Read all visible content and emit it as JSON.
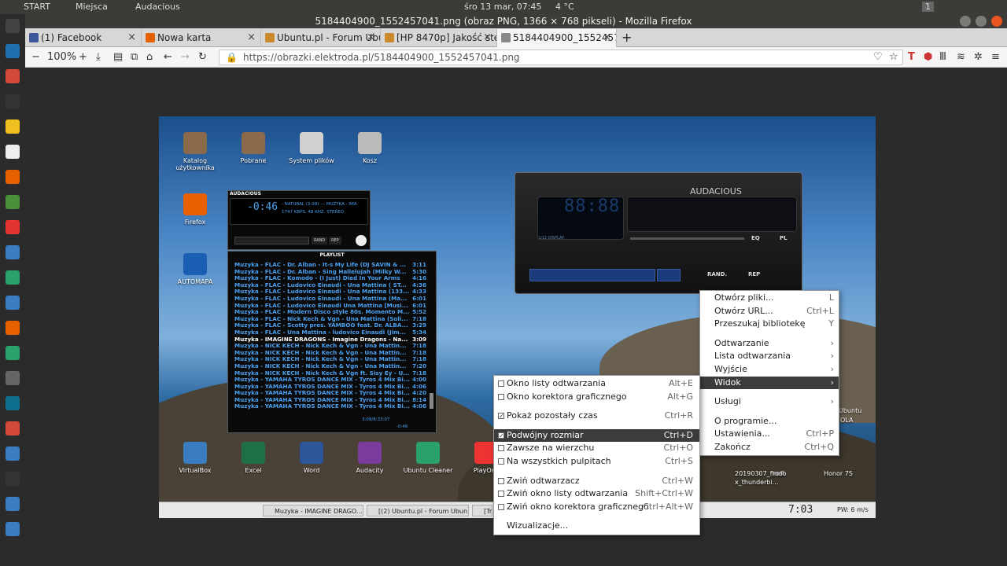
{
  "topbar": {
    "start": "START",
    "places": "Miejsca",
    "app": "Audacious",
    "clock": "śro 13 mar, 07:45",
    "weather": "4 °C",
    "workspace": "1"
  },
  "window": {
    "title": "5184404900_1552457041.png (obraz PNG, 1366 × 768 pikseli) - Mozilla Firefox"
  },
  "tabs": [
    {
      "label": "(1) Facebook",
      "color": "#3b5998"
    },
    {
      "label": "Nowa karta",
      "color": "#e66000"
    },
    {
      "label": "Ubuntu.pl - Forum Ubu",
      "color": "#c98a2b"
    },
    {
      "label": "[HP 8470p] Jakość ste",
      "color": "#c98a2b"
    },
    {
      "label": "5184404900_155245704",
      "color": "#888888"
    }
  ],
  "nav": {
    "zoom": "100%",
    "url": "https://obrazki.elektroda.pl/5184404900_1552457041.png"
  },
  "desktop_icons": [
    {
      "label": "Katalog użytkownika",
      "color": "#8a6a4a"
    },
    {
      "label": "Pobrane",
      "color": "#8a6a4a"
    },
    {
      "label": "System plików",
      "color": "#d0d0d0"
    },
    {
      "label": "Kosz",
      "color": "#bbbbbb"
    },
    {
      "label": "Firefox",
      "color": "#e66000"
    },
    {
      "label": "AUTOMAPA",
      "color": "#1a5fb4"
    }
  ],
  "dock_icons": [
    {
      "label": "VirtualBox",
      "color": "#3a7cc0"
    },
    {
      "label": "Excel",
      "color": "#1d7044"
    },
    {
      "label": "Word",
      "color": "#2b579a"
    },
    {
      "label": "Audacity",
      "color": "#7a3b9c"
    },
    {
      "label": "Ubuntu Cleaner",
      "color": "#2aa06a"
    },
    {
      "label": "PlayOnL",
      "color": "#e33"
    }
  ],
  "right_desktop": {
    "file1": "20190307_firefo",
    "file1b": "x_thunderbi...",
    "root": "root",
    "honor": "Honor 7S",
    "ubuntu": "Ubuntu",
    "ola": "OLA"
  },
  "aud_small": {
    "title": "AUDACIOUS",
    "time": "-0:46",
    "info": "- NATURAL (3:09) --- MUZYKA - IMA",
    "bitrate": "1747 KBPS. 48 KHZ. STEREO",
    "rand": "RAND",
    "rep": "REP",
    "eq": "EQ",
    "pl": "PL"
  },
  "playlist": {
    "title": "PLAYLIST",
    "footer_time": "3:09/8:33:07",
    "footer_pos": "-0:46",
    "rows": [
      {
        "t": "Muzyka - FLAC - Dr. Alban - It-s My Life (DJ SAVIN & ...",
        "d": "3:11"
      },
      {
        "t": "Muzyka - FLAC - Dr. Alban - Sing Hallelujah (Milky W...",
        "d": "5:30"
      },
      {
        "t": "Muzyka - FLAC - Komodo - (I Just) Died In Your Arms",
        "d": "4:16"
      },
      {
        "t": "Muzyka - FLAC - Ludovico Einaudi - Una Mattina ( ST...",
        "d": "4:36"
      },
      {
        "t": "Muzyka - FLAC - Ludovico Einaudi - Una Mattina (133...",
        "d": "4:33"
      },
      {
        "t": "Muzyka - FLAC - Ludovico Einaudi - Una Mattina (Ma...",
        "d": "6:01"
      },
      {
        "t": "Muzyka - FLAC - Ludovico Einaudi Una Mattina [Musi...",
        "d": "6:01"
      },
      {
        "t": "Muzyka - FLAC - Modern Disco style 80s. Momento M...",
        "d": "5:52"
      },
      {
        "t": "Muzyka - FLAC - Nick Kech & Vgn - Una Mattina (Soli...",
        "d": "7:18"
      },
      {
        "t": "Muzyka - FLAC - Scotty pres. YAMBOO feat. Dr. ALBA...",
        "d": "3:29"
      },
      {
        "t": "Muzyka - FLAC - Una Mattina - ludovico Einaudi (Jim...",
        "d": "5:34"
      },
      {
        "t": "Muzyka - IMAGINE DRAGONS - Imagine Dragons - Na...",
        "d": "3:09",
        "cur": true
      },
      {
        "t": "Muzyka - NICK KECH - Nick Kech & Vgn - Una Mattin...",
        "d": "7:18"
      },
      {
        "t": "Muzyka - NICK KECH - Nick Kech & Vgn - Una Mattin...",
        "d": "7:18"
      },
      {
        "t": "Muzyka - NICK KECH - Nick Kech & Vgn - Una Mattin...",
        "d": "7:18"
      },
      {
        "t": "Muzyka - NICK KECH - Nick Kech & Vgn - Una Mattin...",
        "d": "7:20"
      },
      {
        "t": "Muzyka - NICK KECH - Nick Kech & Vgn ft. Sisy Ey - U...",
        "d": "7:18"
      },
      {
        "t": "Muzyka - YAMAHA TYROS DANCE MIX - Tyros 4 Mix Bi...",
        "d": "4:00"
      },
      {
        "t": "Muzyka - YAMAHA TYROS DANCE MIX - Tyros 4 Mix Bi...",
        "d": "4:06"
      },
      {
        "t": "Muzyka - YAMAHA TYROS DANCE MIX - Tyros 4 Mix Bi...",
        "d": "4:20"
      },
      {
        "t": "Muzyka - YAMAHA TYROS DANCE MIX - Tyros 4 Mix Bi...",
        "d": "8:14"
      },
      {
        "t": "Muzyka - YAMAHA TYROS DANCE MIX - Tyros 4 Mix Bi...",
        "d": "4:06"
      }
    ]
  },
  "aud_big": {
    "title": "AUDACIOUS",
    "time": "88:88",
    "display_label": "U12 DISPLAY",
    "eq": "EQ",
    "pl": "PL",
    "rand": "RAND.",
    "rep": "REP"
  },
  "taskbar": {
    "item1": "Muzyka - IMAGINE DRAGO...",
    "item2": "[(2) Ubuntu.pl - Forum Ubun...",
    "item3": "[Tra",
    "clock": "7:03",
    "wind": "PW: 6 m/s"
  },
  "menu_main": [
    {
      "label": "Otwórz pliki...",
      "sc": "L"
    },
    {
      "label": "Otwórz URL...",
      "sc": "Ctrl+L"
    },
    {
      "label": "Przeszukaj bibliotekę",
      "sc": "Y"
    },
    {
      "sep": true
    },
    {
      "label": "Odtwarzanie",
      "sc": "›"
    },
    {
      "label": "Lista odtwarzania",
      "sc": "›"
    },
    {
      "label": "Wyjście",
      "sc": "›"
    },
    {
      "label": "Widok",
      "sc": "›",
      "sel": true
    },
    {
      "sep": true
    },
    {
      "label": "Usługi",
      "sc": "›"
    },
    {
      "sep": true
    },
    {
      "label": "O programie...",
      "sc": ""
    },
    {
      "label": "Ustawienia...",
      "sc": "Ctrl+P"
    },
    {
      "label": "Zakończ",
      "sc": "Ctrl+Q"
    }
  ],
  "menu_view": [
    {
      "label": "Okno listy odtwarzania",
      "sc": "Alt+E",
      "cb": "off"
    },
    {
      "label": "Okno korektora graficznego",
      "sc": "Alt+G",
      "cb": "off"
    },
    {
      "sep": true
    },
    {
      "label": "Pokaż pozostały czas",
      "sc": "Ctrl+R",
      "cb": "on"
    },
    {
      "sep": true
    },
    {
      "label": "Podwójny rozmiar",
      "sc": "Ctrl+D",
      "cb": "on",
      "sel": true
    },
    {
      "label": "Zawsze na wierzchu",
      "sc": "Ctrl+O",
      "cb": "off"
    },
    {
      "label": "Na wszystkich pulpitach",
      "sc": "Ctrl+S",
      "cb": "off"
    },
    {
      "sep": true
    },
    {
      "label": "Zwiń odtwarzacz",
      "sc": "Ctrl+W",
      "cb": "off"
    },
    {
      "label": "Zwiń okno listy odtwarzania",
      "sc": "Shift+Ctrl+W",
      "cb": "off"
    },
    {
      "label": "Zwiń okno korektora graficznego",
      "sc": "Ctrl+Alt+W",
      "cb": "off"
    },
    {
      "sep": true
    },
    {
      "label": "Wizualizacje...",
      "sc": ""
    }
  ],
  "launcher_colors": [
    "#444444",
    "#1f6fb0",
    "#d44a3a",
    "#333333",
    "#f0c020",
    "#eeeeee",
    "#e66000",
    "#4a8f3a",
    "#e33333",
    "#3a7cc0",
    "#2aa06a",
    "#3a7cc0",
    "#e66000",
    "#2aa06a",
    "#666666",
    "#0f6f8f",
    "#d44a3a",
    "#3a7cc0",
    "#333333",
    "#3a7cc0",
    "#3a7cc0"
  ]
}
